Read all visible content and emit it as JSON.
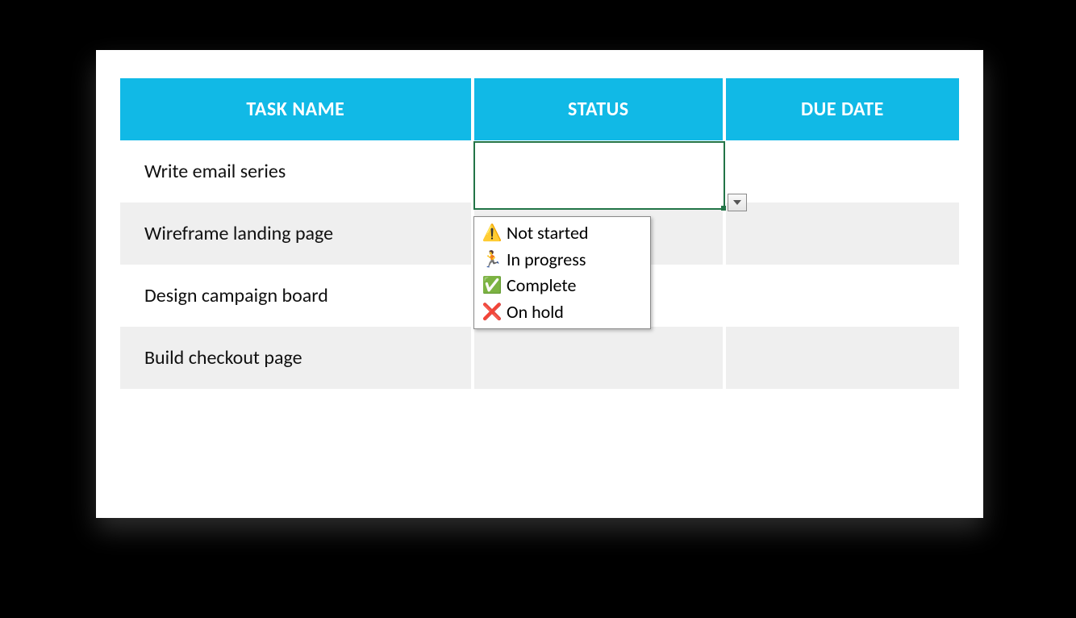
{
  "headers": {
    "task": "TASK NAME",
    "status": "STATUS",
    "due": "DUE DATE"
  },
  "rows": [
    {
      "task": "Write email series",
      "status": "",
      "due": ""
    },
    {
      "task": "Wireframe landing page",
      "status": "",
      "due": ""
    },
    {
      "task": "Design campaign board",
      "status": "",
      "due": ""
    },
    {
      "task": "Build checkout page",
      "status": "",
      "due": ""
    }
  ],
  "dropdown": {
    "options": [
      {
        "icon": "⚠️",
        "label": "Not started"
      },
      {
        "icon": "🏃",
        "label": "In progress"
      },
      {
        "icon": "✅",
        "label": "Complete"
      },
      {
        "icon": "❌",
        "label": "On hold"
      }
    ]
  }
}
